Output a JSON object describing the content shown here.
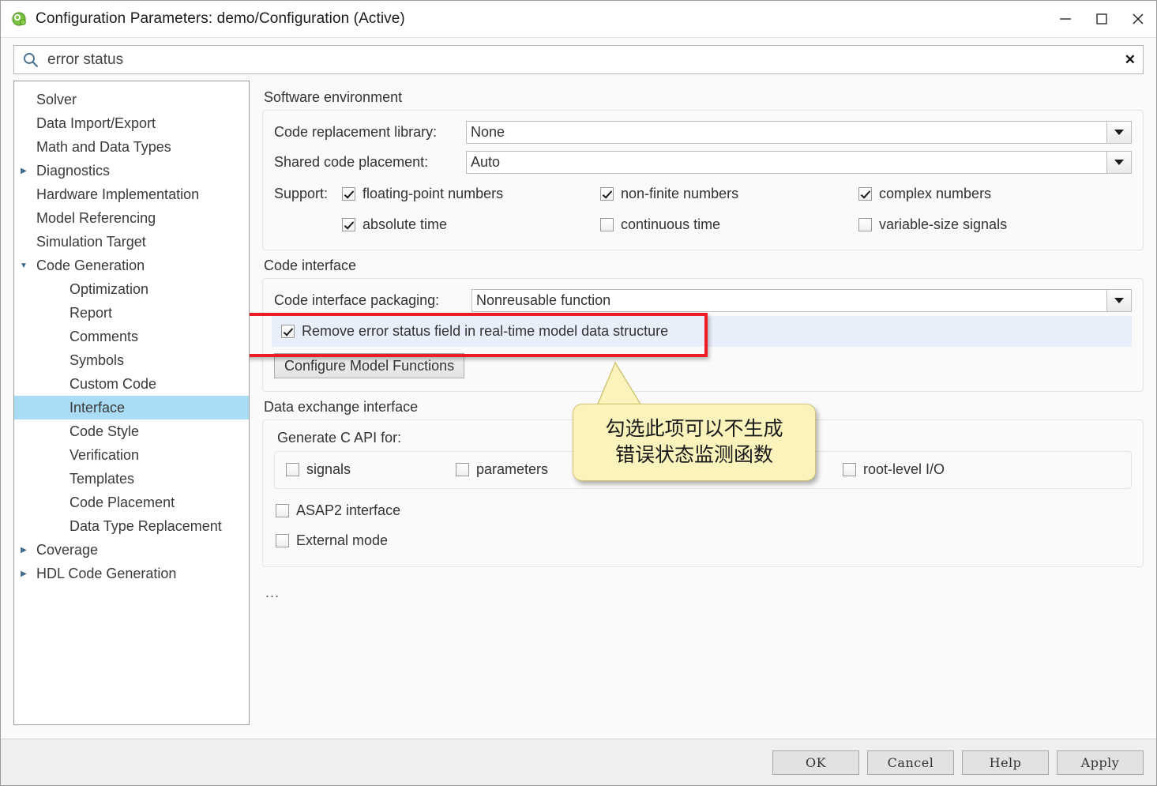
{
  "window": {
    "title": "Configuration Parameters: demo/Configuration (Active)",
    "app_icon": "simulink-icon",
    "minimize": "–",
    "maximize": "□",
    "close": "✕"
  },
  "search": {
    "icon": "search-icon",
    "value": "error status",
    "placeholder": "Search",
    "clear": "✕"
  },
  "tree": {
    "items": [
      {
        "label": "Solver",
        "level": 0,
        "twisty": "none",
        "selected": false
      },
      {
        "label": "Data Import/Export",
        "level": 0,
        "twisty": "none",
        "selected": false
      },
      {
        "label": "Math and Data Types",
        "level": 0,
        "twisty": "none",
        "selected": false
      },
      {
        "label": "Diagnostics",
        "level": 0,
        "twisty": "collapsed",
        "selected": false
      },
      {
        "label": "Hardware Implementation",
        "level": 0,
        "twisty": "none",
        "selected": false
      },
      {
        "label": "Model Referencing",
        "level": 0,
        "twisty": "none",
        "selected": false
      },
      {
        "label": "Simulation Target",
        "level": 0,
        "twisty": "none",
        "selected": false
      },
      {
        "label": "Code Generation",
        "level": 0,
        "twisty": "expanded",
        "selected": false
      },
      {
        "label": "Optimization",
        "level": 1,
        "twisty": "none",
        "selected": false
      },
      {
        "label": "Report",
        "level": 1,
        "twisty": "none",
        "selected": false
      },
      {
        "label": "Comments",
        "level": 1,
        "twisty": "none",
        "selected": false
      },
      {
        "label": "Symbols",
        "level": 1,
        "twisty": "none",
        "selected": false
      },
      {
        "label": "Custom Code",
        "level": 1,
        "twisty": "none",
        "selected": false
      },
      {
        "label": "Interface",
        "level": 1,
        "twisty": "none",
        "selected": true
      },
      {
        "label": "Code Style",
        "level": 1,
        "twisty": "none",
        "selected": false
      },
      {
        "label": "Verification",
        "level": 1,
        "twisty": "none",
        "selected": false
      },
      {
        "label": "Templates",
        "level": 1,
        "twisty": "none",
        "selected": false
      },
      {
        "label": "Code Placement",
        "level": 1,
        "twisty": "none",
        "selected": false
      },
      {
        "label": "Data Type Replacement",
        "level": 1,
        "twisty": "none",
        "selected": false
      },
      {
        "label": "Coverage",
        "level": 0,
        "twisty": "collapsed",
        "selected": false
      },
      {
        "label": "HDL Code Generation",
        "level": 0,
        "twisty": "collapsed",
        "selected": false
      }
    ]
  },
  "software_environment": {
    "group_title": "Software environment",
    "code_replacement_library": {
      "label": "Code replacement library:",
      "value": "None"
    },
    "shared_code_placement": {
      "label": "Shared code placement:",
      "value": "Auto"
    },
    "support_label": "Support:",
    "support_options": [
      {
        "label": "floating-point numbers",
        "checked": true
      },
      {
        "label": "non-finite numbers",
        "checked": true
      },
      {
        "label": "complex numbers",
        "checked": true
      },
      {
        "label": "absolute time",
        "checked": true
      },
      {
        "label": "continuous time",
        "checked": false
      },
      {
        "label": "variable-size signals",
        "checked": false
      }
    ]
  },
  "code_interface": {
    "group_title": "Code interface",
    "packaging": {
      "label": "Code interface packaging:",
      "value": "Nonreusable function"
    },
    "remove_error_status": {
      "label": "Remove error status field in real-time model data structure",
      "checked": true
    },
    "configure_button": "Configure Model Functions"
  },
  "data_exchange": {
    "group_title": "Data exchange interface",
    "generate_c_api_label": "Generate C API for:",
    "c_api_options": [
      {
        "label": "signals",
        "checked": false
      },
      {
        "label": "parameters",
        "checked": false
      },
      {
        "label": "root-level I/O",
        "checked": false
      }
    ],
    "other_options": [
      {
        "label": "ASAP2 interface",
        "checked": false
      },
      {
        "label": "External mode",
        "checked": false
      }
    ],
    "overflow_indicator": "..."
  },
  "callout": {
    "line1": "勾选此项可以不生成",
    "line2": "错误状态监测函数",
    "fill_color": "#faf4bc",
    "border_color": "#cfc472"
  },
  "annotation": {
    "highlight_color": "#ed1c24"
  },
  "footer": {
    "buttons": [
      {
        "label": "OK"
      },
      {
        "label": "Cancel"
      },
      {
        "label": "Help"
      },
      {
        "label": "Apply"
      }
    ]
  }
}
